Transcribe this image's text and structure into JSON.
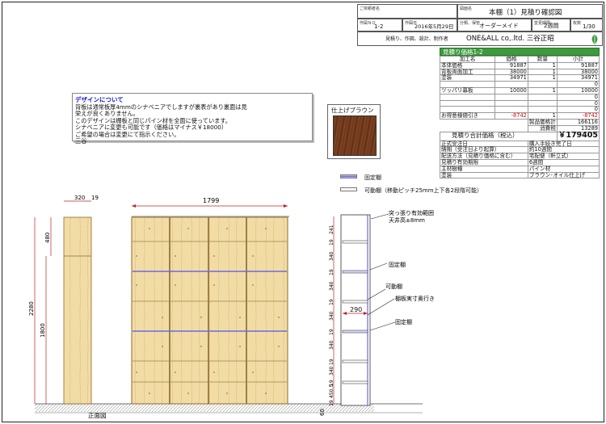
{
  "title_block": {
    "customer_label": "ご依頼者名",
    "drawing_name_label": "図面名",
    "drawing_name": "本棚（1）見積り確認図",
    "drawing_no_label": "作図ＮＯ",
    "drawing_no": "1-2",
    "date_label": "作図日",
    "date": "2016年5月29日",
    "category_label": "分類、保管",
    "category": "オーダーメイド",
    "period_label": "変更期限",
    "period": "2週間",
    "pages_label": "枚数",
    "pages": "1/30",
    "company_caption": "見積り、作図、設計、制作者",
    "company": "ONE&ALL co,.ltd.  三谷正昭"
  },
  "note": {
    "title": "デザインについて",
    "lines": [
      "背板は通常板厚4mmのシナベニアでしますが裏表があり裏面は見",
      "栄えが良くありません。",
      "このデザインは棚板と同じパイン材を全面に使っています。",
      "シナベニアに変更も可能です（価格はマイナス￥18000）",
      "ご希望の場合は変更にて指示ください。",
      "三谷"
    ]
  },
  "finish_sample": {
    "label": "仕上げブラウン"
  },
  "estimate": {
    "header": "見積り価格1-2",
    "columns": [
      "加工名",
      "価格",
      "数量",
      "小計"
    ],
    "rows": [
      {
        "name": "本体価格",
        "price": "91887",
        "qty": "1",
        "subtotal": "91887"
      },
      {
        "name": "背板両面加工",
        "price": "38000",
        "qty": "1",
        "subtotal": "38000"
      },
      {
        "name": "塗装",
        "price": "34971",
        "qty": "1",
        "subtotal": "34971"
      },
      {
        "name": "",
        "price": "",
        "qty": "",
        "subtotal": "0"
      },
      {
        "name": "ツッパリ幕板",
        "price": "10000",
        "qty": "1",
        "subtotal": "10000"
      },
      {
        "name": "",
        "price": "",
        "qty": "",
        "subtotal": "0"
      },
      {
        "name": "",
        "price": "",
        "qty": "",
        "subtotal": "0"
      },
      {
        "name": "",
        "price": "",
        "qty": "",
        "subtotal": "0"
      },
      {
        "name": "お得意様値引き",
        "price": "-8742",
        "qty": "1",
        "subtotal": "-8742"
      }
    ],
    "product_total_label": "製品価格計",
    "product_total": "166116",
    "tax_label": "消費税",
    "tax": "13289",
    "grand_label": "見積り合計価格（税込）",
    "grand_total": "￥179405",
    "info": [
      {
        "k": "正式受注日",
        "v": "購入手続き完了日"
      },
      {
        "k": "納期（受注日より起算）",
        "v": "約10週間"
      },
      {
        "k": "配送方法（見積り価格に含む）",
        "v": "宅配便（軒立式）"
      },
      {
        "k": "見積り有効期限",
        "v": "6週間"
      },
      {
        "k": "主材樹種",
        "v": "パイン材"
      },
      {
        "k": "塗装",
        "v": "ブラウン･オイル仕上げ"
      }
    ]
  },
  "legend": {
    "fixed": "固定棚",
    "movable": "可動棚（移動ピッチ25mm上下各2段階可能）"
  },
  "drawing": {
    "dim_320": "320",
    "dim_19a": "19",
    "dim_1799": "1799",
    "dim_480": "480",
    "dim_2280": "2280",
    "dim_1800": "1800",
    "side_dims": [
      "241",
      "19",
      "340",
      "19",
      "340",
      "19",
      "340",
      "19",
      "340",
      "19",
      "340",
      "19",
      "450.5",
      "19"
    ],
    "dim_290": "290",
    "dim_60": "60",
    "front_label": "正面図",
    "callout_tsuppari": "突っ張り有効範囲",
    "callout_tenjo": "天井高±8mm",
    "callout_fixed1": "固定棚",
    "callout_movable": "可動棚",
    "callout_depth": "棚板実寸奥行き",
    "callout_fixed2": "固定棚"
  },
  "colors": {
    "wood": "#f0d9a0",
    "wood_dark": "#8a6a2a",
    "accent_green": "#3d9a3d",
    "fixed_shelf": "#6a6ae0",
    "dim_red": "#c02020"
  }
}
